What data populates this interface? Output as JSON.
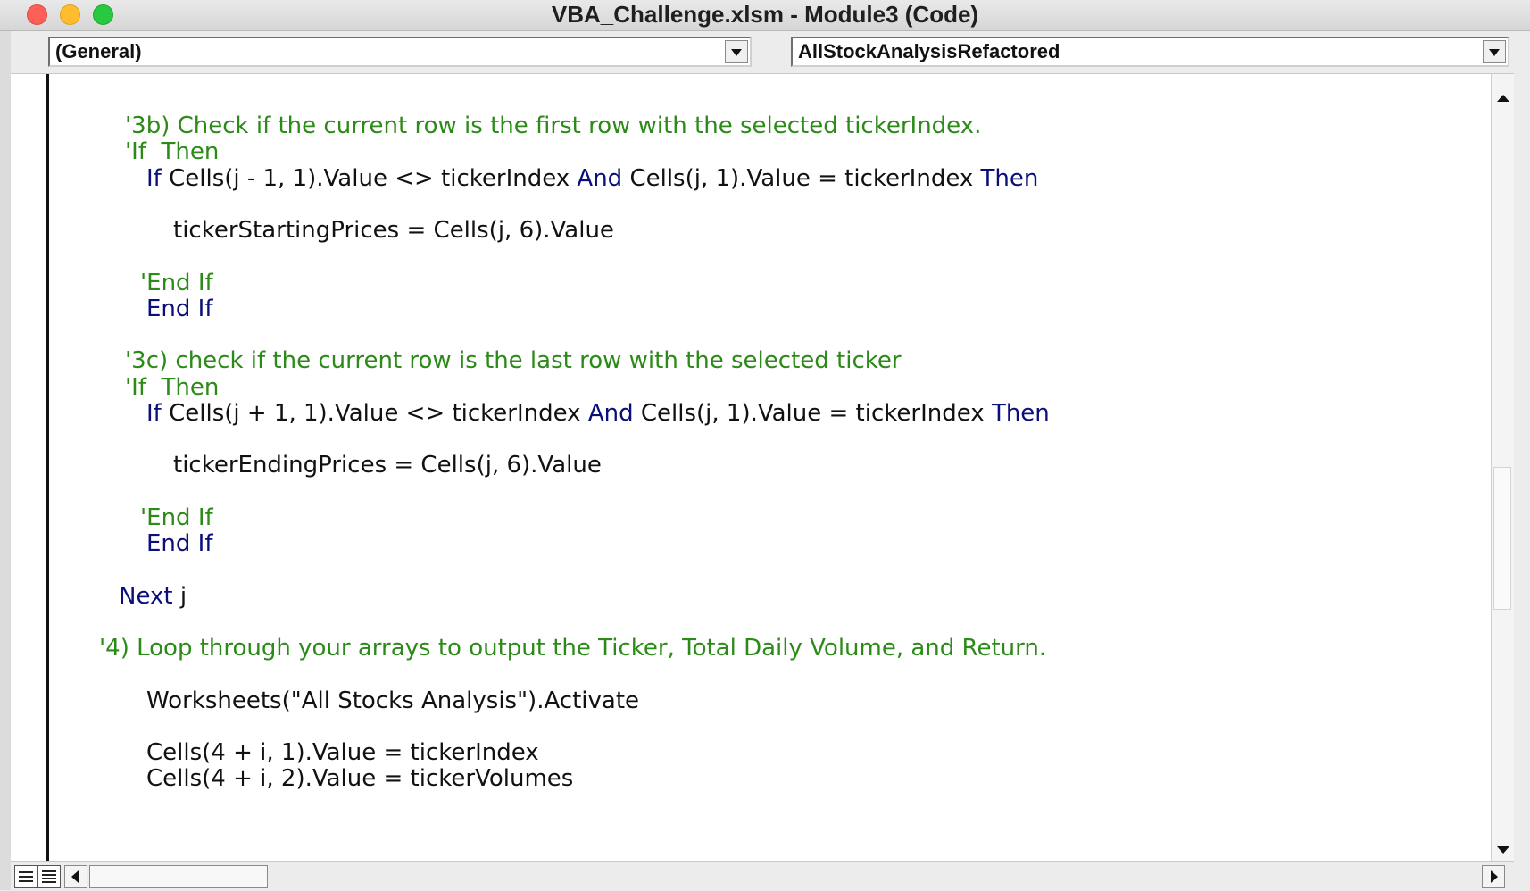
{
  "window": {
    "title": "VBA_Challenge.xlsm - Module3 (Code)"
  },
  "selectors": {
    "object": "(General)",
    "procedure": "AllStockAnalysisRefactored"
  },
  "colors": {
    "comment": "#2c8a18",
    "keyword": "#0a0f7a",
    "text": "#111111"
  },
  "code": {
    "lines": [
      [
        {
          "t": "'3b) Check if the current row is the first row with the selected tickerIndex.",
          "k": "cmt"
        }
      ],
      [
        {
          "t": "'If  Then",
          "k": "cmt"
        }
      ],
      [
        {
          "t": "If",
          "k": "kw"
        },
        {
          "t": " Cells(j - 1, 1).Value <> tickerIndex ",
          "k": "txt"
        },
        {
          "t": "And",
          "k": "kw"
        },
        {
          "t": " Cells(j, 1).Value = tickerIndex ",
          "k": "txt"
        },
        {
          "t": "Then",
          "k": "kw"
        }
      ],
      [],
      [
        {
          "t": "tickerStartingPrices = Cells(j, 6).Value",
          "k": "txt"
        }
      ],
      [],
      [
        {
          "t": "'End If",
          "k": "cmt"
        }
      ],
      [
        {
          "t": "End If",
          "k": "kw"
        }
      ],
      [],
      [
        {
          "t": "'3c) check if the current row is the last row with the selected ticker",
          "k": "cmt"
        }
      ],
      [
        {
          "t": "'If  Then",
          "k": "cmt"
        }
      ],
      [
        {
          "t": "If",
          "k": "kw"
        },
        {
          "t": " Cells(j + 1, 1).Value <> tickerIndex ",
          "k": "txt"
        },
        {
          "t": "And",
          "k": "kw"
        },
        {
          "t": " Cells(j, 1).Value = tickerIndex ",
          "k": "txt"
        },
        {
          "t": "Then",
          "k": "kw"
        }
      ],
      [],
      [
        {
          "t": "tickerEndingPrices = Cells(j, 6).Value",
          "k": "txt"
        }
      ],
      [],
      [
        {
          "t": "'End If",
          "k": "cmt"
        }
      ],
      [
        {
          "t": "End If",
          "k": "kw"
        }
      ],
      [],
      [
        {
          "t": "Next",
          "k": "kw"
        },
        {
          "t": " j",
          "k": "txt"
        }
      ],
      [],
      [
        {
          "t": "'4) Loop through your arrays to output the Ticker, Total Daily Volume, and Return.",
          "k": "cmt"
        }
      ],
      [],
      [
        {
          "t": "Worksheets(\"All Stocks Analysis\").Activate",
          "k": "txt"
        }
      ],
      [],
      [
        {
          "t": "Cells(4 + i, 1).Value = tickerIndex",
          "k": "txt"
        }
      ],
      [
        {
          "t": "Cells(4 + i, 2).Value = tickerVolumes",
          "k": "txt"
        }
      ]
    ]
  }
}
